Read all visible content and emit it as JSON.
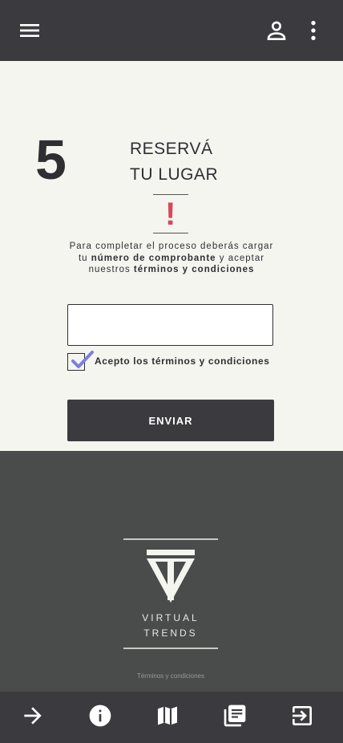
{
  "step": {
    "number": "5",
    "title_line1": "RESERVÁ",
    "title_line2": "TU LUGAR"
  },
  "instructions": {
    "part1": "Para completar el proceso deberás cargar tu ",
    "bold1": "número de comprobante",
    "part2": " y aceptar nuestros ",
    "bold2": "términos y condiciones"
  },
  "form": {
    "code_input_value": "",
    "terms_checked": true,
    "terms_label": "Acepto los términos y condiciones",
    "submit_label": "ENVIAR"
  },
  "footer": {
    "brand_line1": "VIRTUAL",
    "brand_line2": "TRENDS",
    "terms_link": "Términos y condiciones"
  },
  "icons": {
    "top": [
      "menu-icon",
      "account-icon",
      "more-vert-icon"
    ],
    "bottom": [
      "arrow-forward-icon",
      "info-icon",
      "map-icon",
      "library-books-icon",
      "exit-to-app-icon"
    ]
  },
  "colors": {
    "bar": "#3b3b3f",
    "footer": "#4a4b4b",
    "accent": "#d7495a",
    "check": "#7b7fe0"
  }
}
